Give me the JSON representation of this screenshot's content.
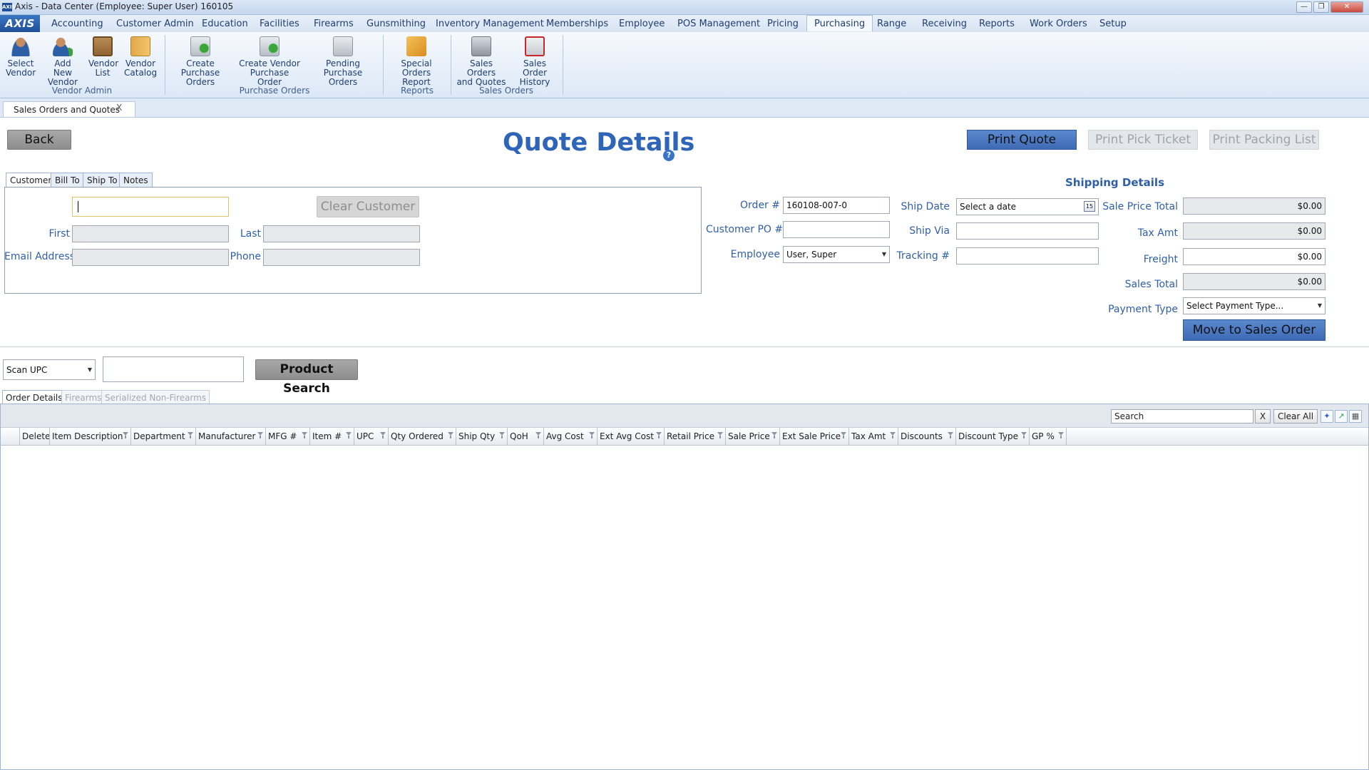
{
  "window": {
    "app_icon": "AXIS",
    "title": "Axis - Data Center  (Employee: Super User) 160105"
  },
  "menu": {
    "logo": "AXIS",
    "items": [
      "Accounting",
      "Customer Admin",
      "Education",
      "Facilities",
      "Firearms",
      "Gunsmithing",
      "Inventory Management",
      "Memberships",
      "Employee",
      "POS Management",
      "Pricing",
      "Purchasing",
      "Range",
      "Receiving",
      "Reports",
      "Work Orders",
      "Setup"
    ],
    "active": "Purchasing"
  },
  "ribbon": {
    "buttons": [
      {
        "line1": "Select",
        "line2": "Vendor",
        "icon": "vendor-person-icon"
      },
      {
        "line1": "Add New",
        "line2": "Vendor",
        "icon": "add-person-icon"
      },
      {
        "line1": "Vendor",
        "line2": "List",
        "icon": "clipboard-icon"
      },
      {
        "line1": "Vendor",
        "line2": "Catalog",
        "icon": "catalog-icon"
      },
      {
        "line1": "Create Purchase",
        "line2": "Orders",
        "icon": "add-order-icon"
      },
      {
        "line1": "Create Vendor",
        "line2": "Purchase Order",
        "icon": "add-order-icon"
      },
      {
        "line1": "Pending Purchase",
        "line2": "Orders",
        "icon": "pending-order-icon"
      },
      {
        "line1": "Special Orders",
        "line2": "Report",
        "icon": "report-pencil-icon"
      },
      {
        "line1": "Sales Orders",
        "line2": "and Quotes",
        "icon": "sales-orders-icon"
      },
      {
        "line1": "Sales Order",
        "line2": "History",
        "icon": "paid-stamp-icon"
      }
    ],
    "groups": [
      "Vendor Admin",
      "Purchase Orders",
      "Reports",
      "Sales Orders"
    ]
  },
  "doc_tab": {
    "label": "Sales Orders and Quotes",
    "close": "X"
  },
  "actions": {
    "back": "Back",
    "print_quote": "Print Quote",
    "print_pick_ticket": "Print Pick Ticket",
    "print_packing_list": "Print Packing List"
  },
  "page_title": "Quote Details",
  "help_icon": "?",
  "customer_tabs": [
    "Customer",
    "Bill To",
    "Ship To",
    "Notes"
  ],
  "customer": {
    "search_value": "",
    "clear_label": "Clear Customer",
    "first_label": "First",
    "last_label": "Last",
    "email_label": "Email Address",
    "phone_label": "Phone",
    "first": "",
    "last": "",
    "email": "",
    "phone": ""
  },
  "order": {
    "order_label": "Order #",
    "order_value": "160108-007-0",
    "po_label": "Customer PO #",
    "po_value": "",
    "employee_label": "Employee",
    "employee_value": "User, Super"
  },
  "shipping": {
    "heading": "Shipping Details",
    "ship_date_label": "Ship Date",
    "ship_date_placeholder": "Select a date",
    "ship_via_label": "Ship Via",
    "tracking_label": "Tracking #"
  },
  "totals": {
    "sale_price_total_label": "Sale Price Total",
    "sale_price_total": "$0.00",
    "tax_label": "Tax Amt",
    "tax": "$0.00",
    "freight_label": "Freight",
    "freight": "$0.00",
    "sales_total_label": "Sales Total",
    "sales_total": "$0.00",
    "payment_type_label": "Payment Type",
    "payment_type_value": "Select Payment Type...",
    "move_label": "Move to Sales Order"
  },
  "scan": {
    "mode": "Scan UPC",
    "value": "",
    "product_search": "Product Search"
  },
  "order_tabs": [
    "Order Details",
    "Firearms",
    "Serialized Non-Firearms"
  ],
  "grid": {
    "search_placeholder": "Search",
    "clear_x": "X",
    "clear_all": "Clear All",
    "columns": [
      "Delete",
      "Item Description",
      "Department",
      "Manufacturer",
      "MFG #",
      "Item #",
      "UPC",
      "Qty Ordered",
      "Ship Qty",
      "QoH",
      "Avg Cost",
      "Ext Avg Cost",
      "Retail Price",
      "Sale Price",
      "Ext Sale Price",
      "Tax Amt",
      "Discounts",
      "Discount Type",
      "GP %"
    ],
    "rows": []
  },
  "colors": {
    "accent": "#2f65b8",
    "primary_button": "#4a77c2",
    "disabled_text": "#9ea4ac"
  }
}
